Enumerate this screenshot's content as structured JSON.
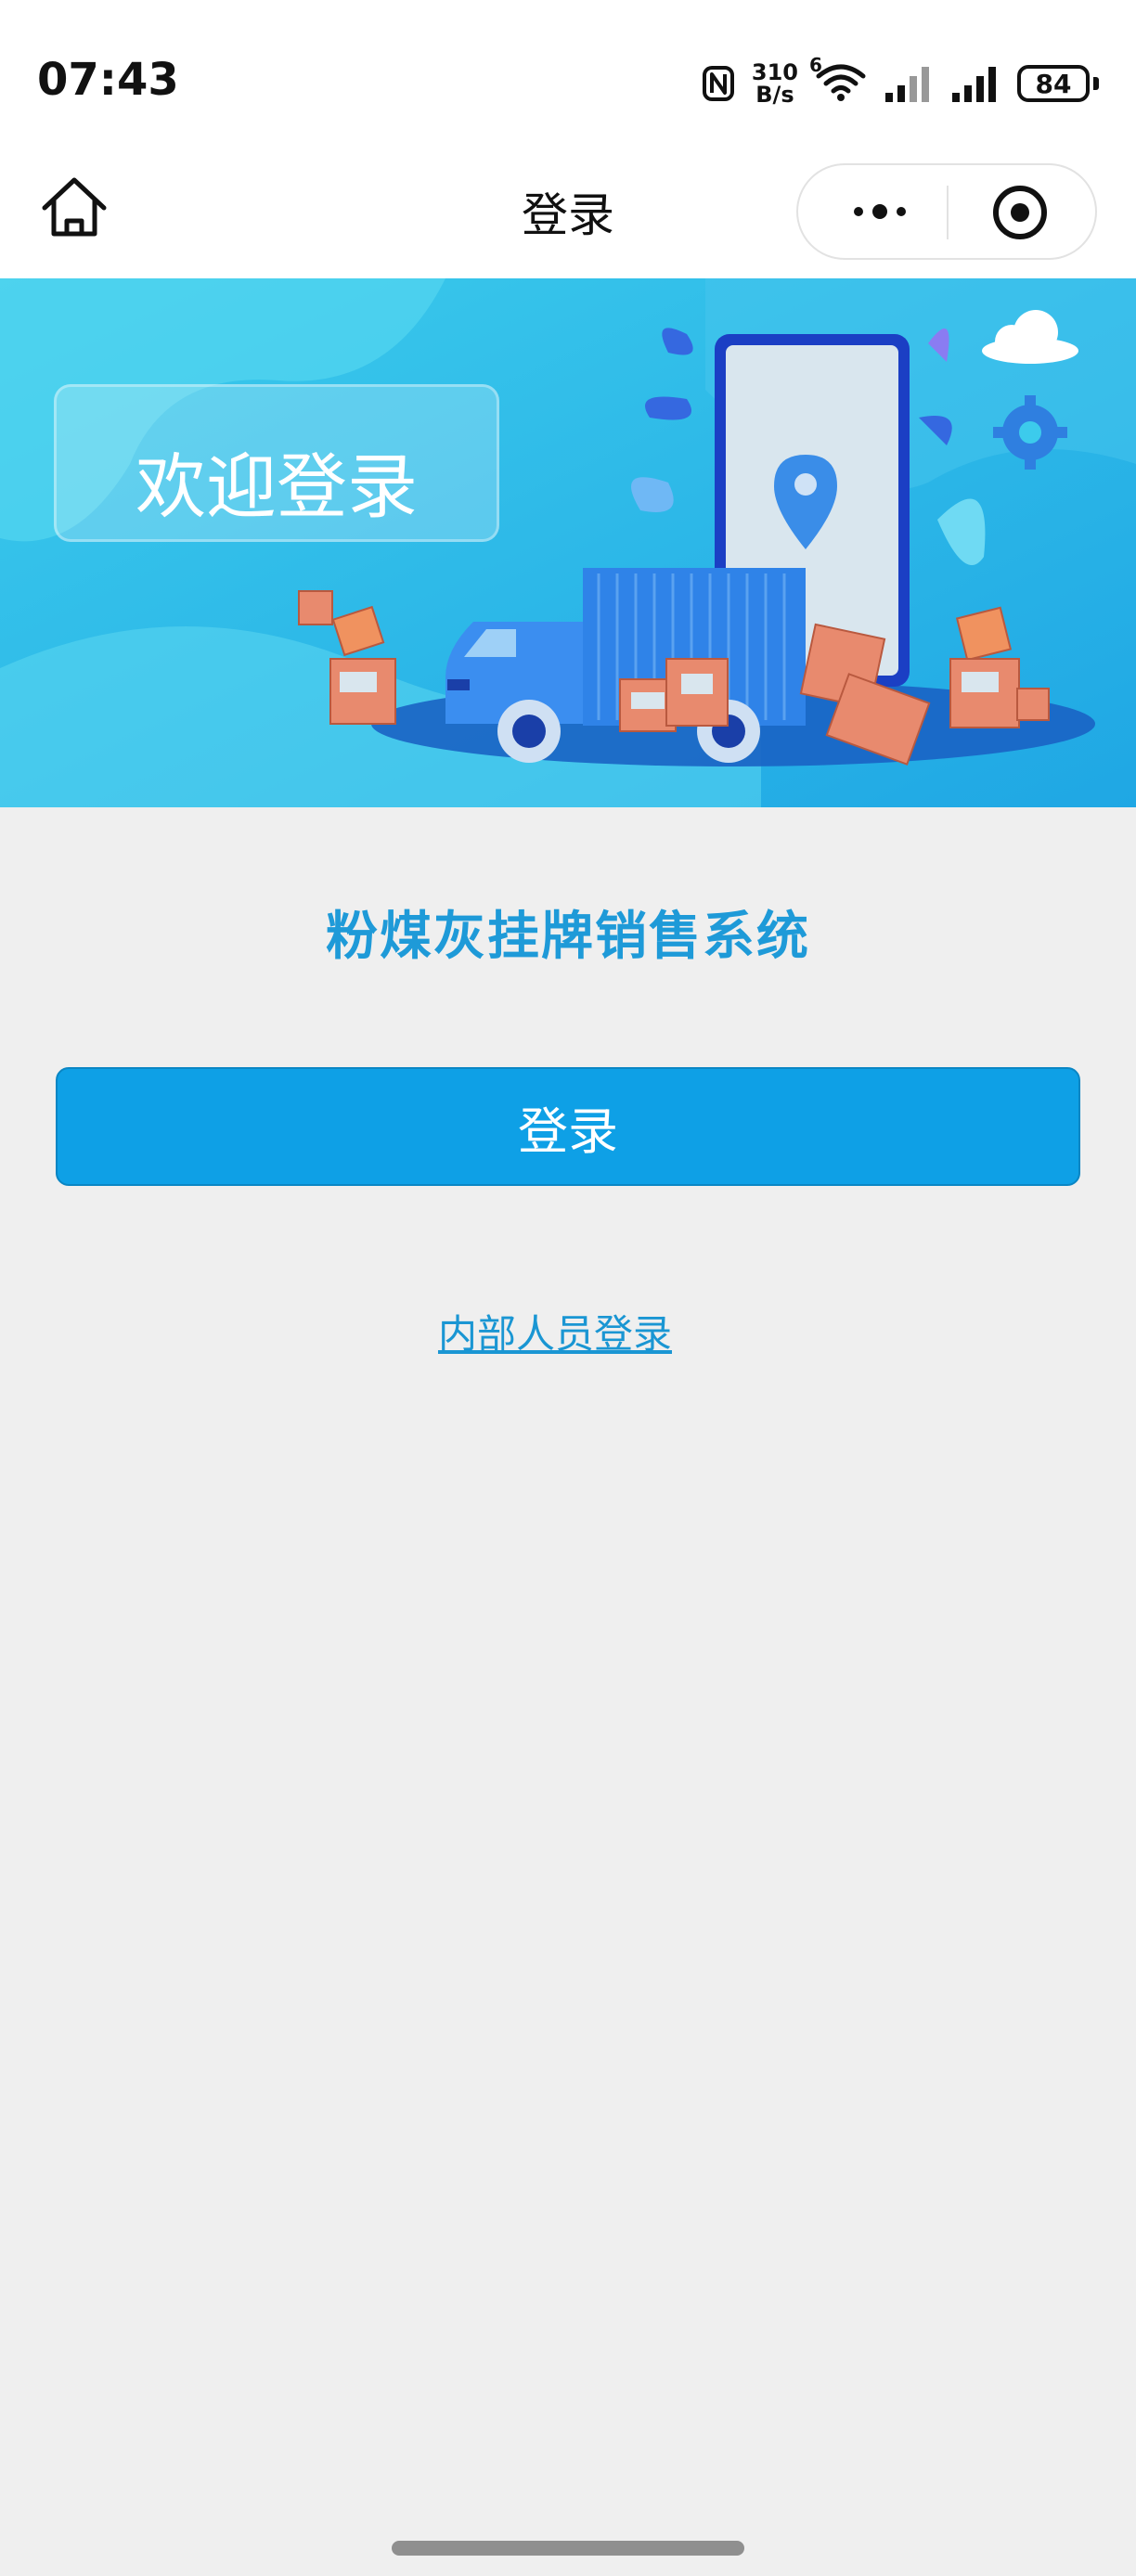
{
  "status_bar": {
    "time": "07:43",
    "net_speed_value": "310",
    "net_speed_unit": "B/s",
    "wifi_badge": "6",
    "battery": "84"
  },
  "nav": {
    "title": "登录"
  },
  "banner": {
    "welcome": "欢迎登录"
  },
  "main": {
    "system_name": "粉煤灰挂牌销售系统",
    "login_label": "登录",
    "staff_login_label": "内部人员登录"
  },
  "colors": {
    "accent": "#0ea0e6",
    "title_blue": "#1e9ad8",
    "banner_sky": "#2bb8ea",
    "page_bg": "#efefef"
  },
  "icons": [
    "nfc-icon",
    "wifi-icon",
    "signal-icon",
    "battery-icon",
    "home-icon",
    "more-icon",
    "close-circle-icon",
    "location-pin-icon",
    "gear-icon",
    "cloud-icon",
    "truck-icon"
  ]
}
